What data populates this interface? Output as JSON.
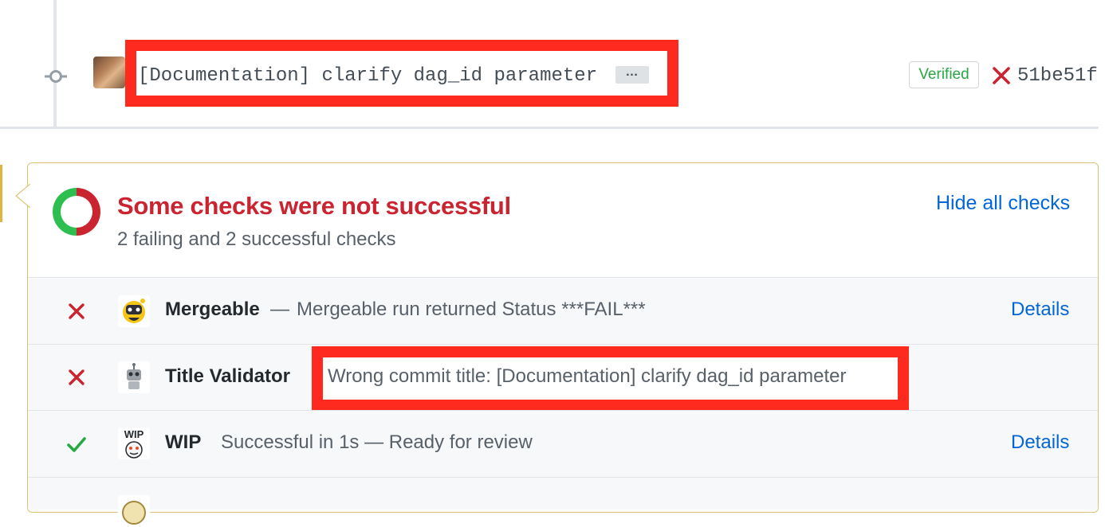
{
  "commit": {
    "title": "[Documentation] clarify dag_id parameter",
    "ellipsis_label": "…",
    "verified_label": "Verified",
    "sha": "51be51f"
  },
  "checks": {
    "headline": "Some checks were not successful",
    "summary": "2 failing and 2 successful checks",
    "hide_label": "Hide all checks",
    "items": [
      {
        "status": "failure",
        "name": "Mergeable",
        "separator": "—",
        "description": "Mergeable run returned Status ***FAIL***",
        "details_label": "Details"
      },
      {
        "status": "failure",
        "name": "Title Validator",
        "separator": "—",
        "description": "Wrong commit title: [Documentation] clarify dag_id parameter",
        "details_label": ""
      },
      {
        "status": "success",
        "name": "WIP",
        "separator": "",
        "description": "Successful in 1s — Ready for review",
        "details_label": "Details"
      }
    ]
  },
  "colors": {
    "failure": "#cb2431",
    "success": "#28a745",
    "link": "#0366d6",
    "highlight": "#ff2a1f",
    "pending_border": "#dfc374"
  },
  "icons": {
    "commit": "git-commit-icon",
    "fail": "x-icon",
    "pass": "check-icon",
    "donut": "checks-donut-icon"
  }
}
